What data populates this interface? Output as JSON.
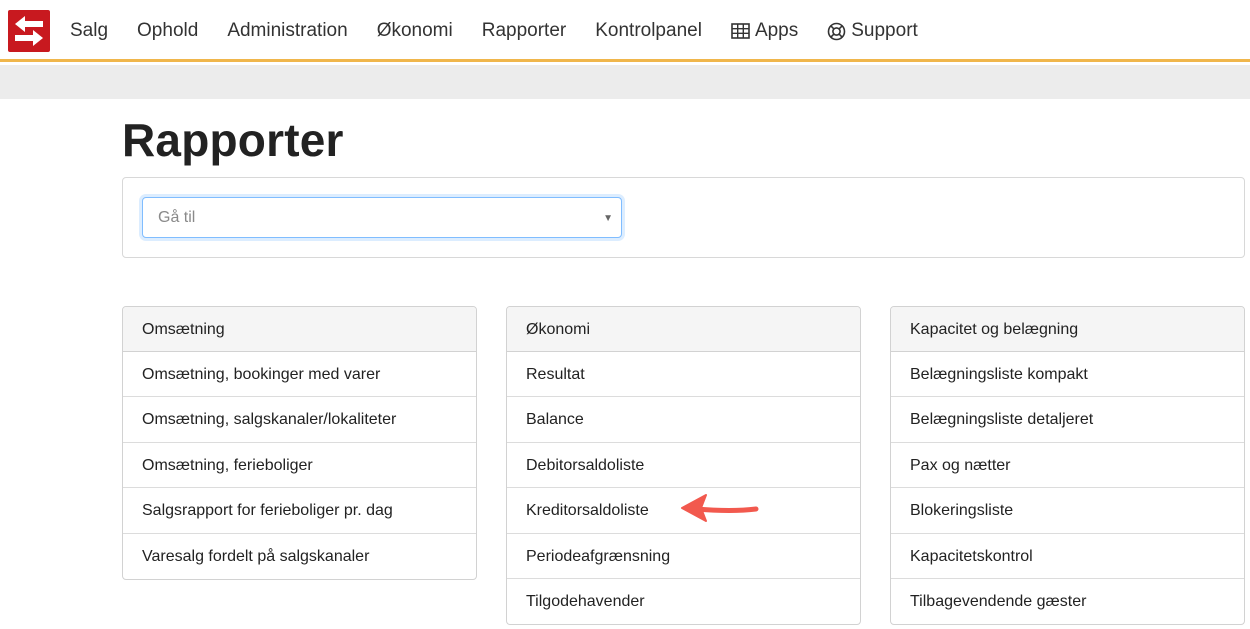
{
  "nav": {
    "items": [
      {
        "label": "Salg"
      },
      {
        "label": "Ophold"
      },
      {
        "label": "Administration"
      },
      {
        "label": "Økonomi"
      },
      {
        "label": "Rapporter"
      },
      {
        "label": "Kontrolpanel"
      },
      {
        "label": "Apps",
        "icon": "grid-icon"
      },
      {
        "label": "Support",
        "icon": "lifebuoy-icon"
      }
    ]
  },
  "page": {
    "title": "Rapporter",
    "goto_placeholder": "Gå til"
  },
  "cards": [
    {
      "title": "Omsætning",
      "items": [
        "Omsætning, bookinger med varer",
        "Omsætning, salgskanaler/lokaliteter",
        "Omsætning, ferieboliger",
        "Salgsrapport for ferieboliger pr. dag",
        "Varesalg fordelt på salgskanaler"
      ]
    },
    {
      "title": "Økonomi",
      "items": [
        "Resultat",
        "Balance",
        "Debitorsaldoliste",
        "Kreditorsaldoliste",
        "Periodeafgrænsning",
        "Tilgodehavender"
      ]
    },
    {
      "title": "Kapacitet og belægning",
      "items": [
        "Belægningsliste kompakt",
        "Belægningsliste detaljeret",
        "Pax og nætter",
        "Blokeringsliste",
        "Kapacitetskontrol",
        "Tilbagevendende gæster"
      ]
    }
  ],
  "colors": {
    "brand": "#c8191f",
    "nav_underline": "#f0b64b",
    "annotation_arrow": "#f2594e"
  }
}
